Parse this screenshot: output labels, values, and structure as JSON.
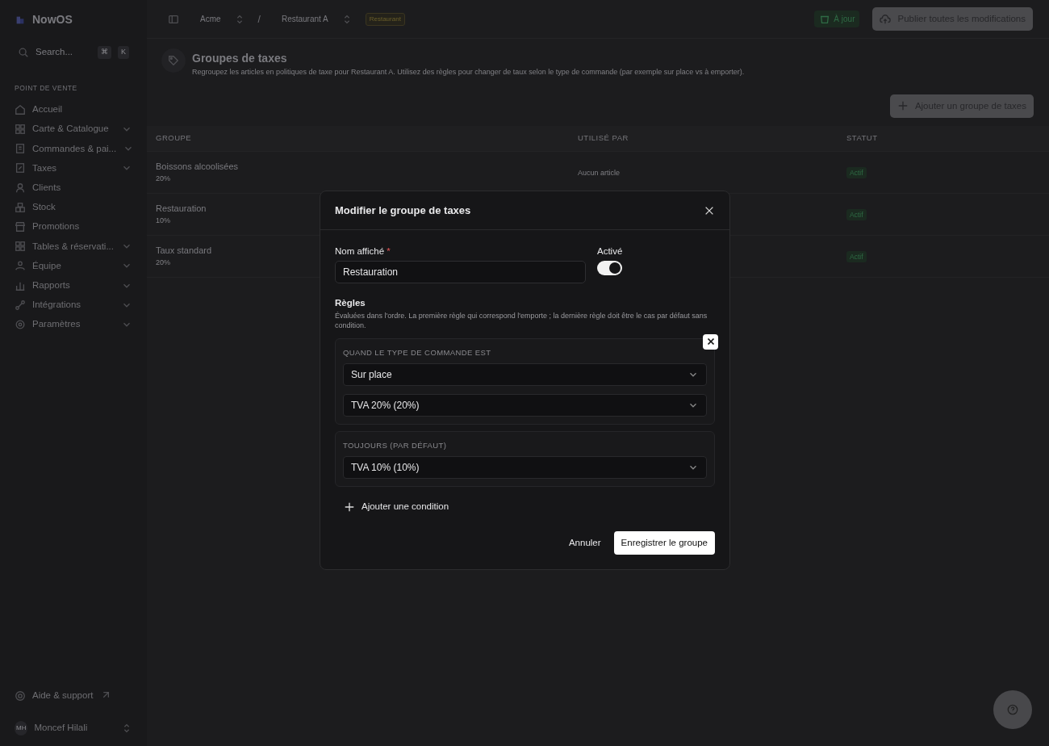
{
  "sidebar": {
    "brand": "NowOS",
    "search": {
      "placeholder": "Search...",
      "shortcut": [
        "⌘",
        "K"
      ]
    },
    "section": "POINT DE VENTE",
    "items": [
      {
        "label": "Accueil",
        "expandable": false
      },
      {
        "label": "Carte & Catalogue",
        "expandable": true
      },
      {
        "label": "Commandes & pai...",
        "expandable": true
      },
      {
        "label": "Taxes",
        "expandable": true
      },
      {
        "label": "Clients",
        "expandable": false
      },
      {
        "label": "Stock",
        "expandable": false
      },
      {
        "label": "Promotions",
        "expandable": false
      },
      {
        "label": "Tables & réservati...",
        "expandable": true
      },
      {
        "label": "Équipe",
        "expandable": true
      },
      {
        "label": "Rapports",
        "expandable": true
      },
      {
        "label": "Intégrations",
        "expandable": true
      },
      {
        "label": "Paramètres",
        "expandable": true
      }
    ],
    "help": "Aide & support",
    "user": {
      "initials": "MH",
      "name": "Moncef Hilali"
    }
  },
  "topbar": {
    "breadcrumbs": [
      "Acme",
      "Restaurant A"
    ],
    "separator": "/",
    "tag": "Restaurant",
    "status": "À jour",
    "publish": "Publier toutes les modifications"
  },
  "page": {
    "title": "Groupes de taxes",
    "subtitle": "Regroupez les articles en politiques de taxe pour Restaurant A. Utilisez des règles pour changer de taux selon le type de commande (par exemple sur place vs à emporter).",
    "add_button": "Ajouter un groupe de taxes"
  },
  "table": {
    "columns": [
      "GROUPE",
      "UTILISÉ PAR",
      "STATUT"
    ],
    "rows": [
      {
        "name": "Boissons alcoolisées",
        "rate": "20%",
        "used_by": "Aucun article",
        "status": "Actif"
      },
      {
        "name": "Restauration",
        "rate": "10%",
        "status": "Actif"
      },
      {
        "name": "Taux standard",
        "rate": "20%",
        "status": "Actif"
      }
    ]
  },
  "modal": {
    "title": "Modifier le groupe de taxes",
    "name_label": "Nom affiché",
    "required_mark": "*",
    "name_value": "Restauration",
    "active_label": "Activé",
    "active": true,
    "rules_title": "Règles",
    "rules_help": "Évaluées dans l'ordre. La première règle qui correspond l'emporte ; la dernière règle doit être le cas par défaut sans condition.",
    "rules": [
      {
        "kind": "conditional",
        "label": "QUAND LE TYPE DE COMMANDE EST",
        "condition": "Sur place",
        "tax": "TVA 20% (20%)",
        "removable": true
      },
      {
        "kind": "default",
        "label": "TOUJOURS (PAR DÉFAUT)",
        "tax": "TVA 10% (10%)",
        "removable": false
      }
    ],
    "add_condition": "Ajouter une condition",
    "cancel": "Annuler",
    "save": "Enregistrer le groupe"
  }
}
